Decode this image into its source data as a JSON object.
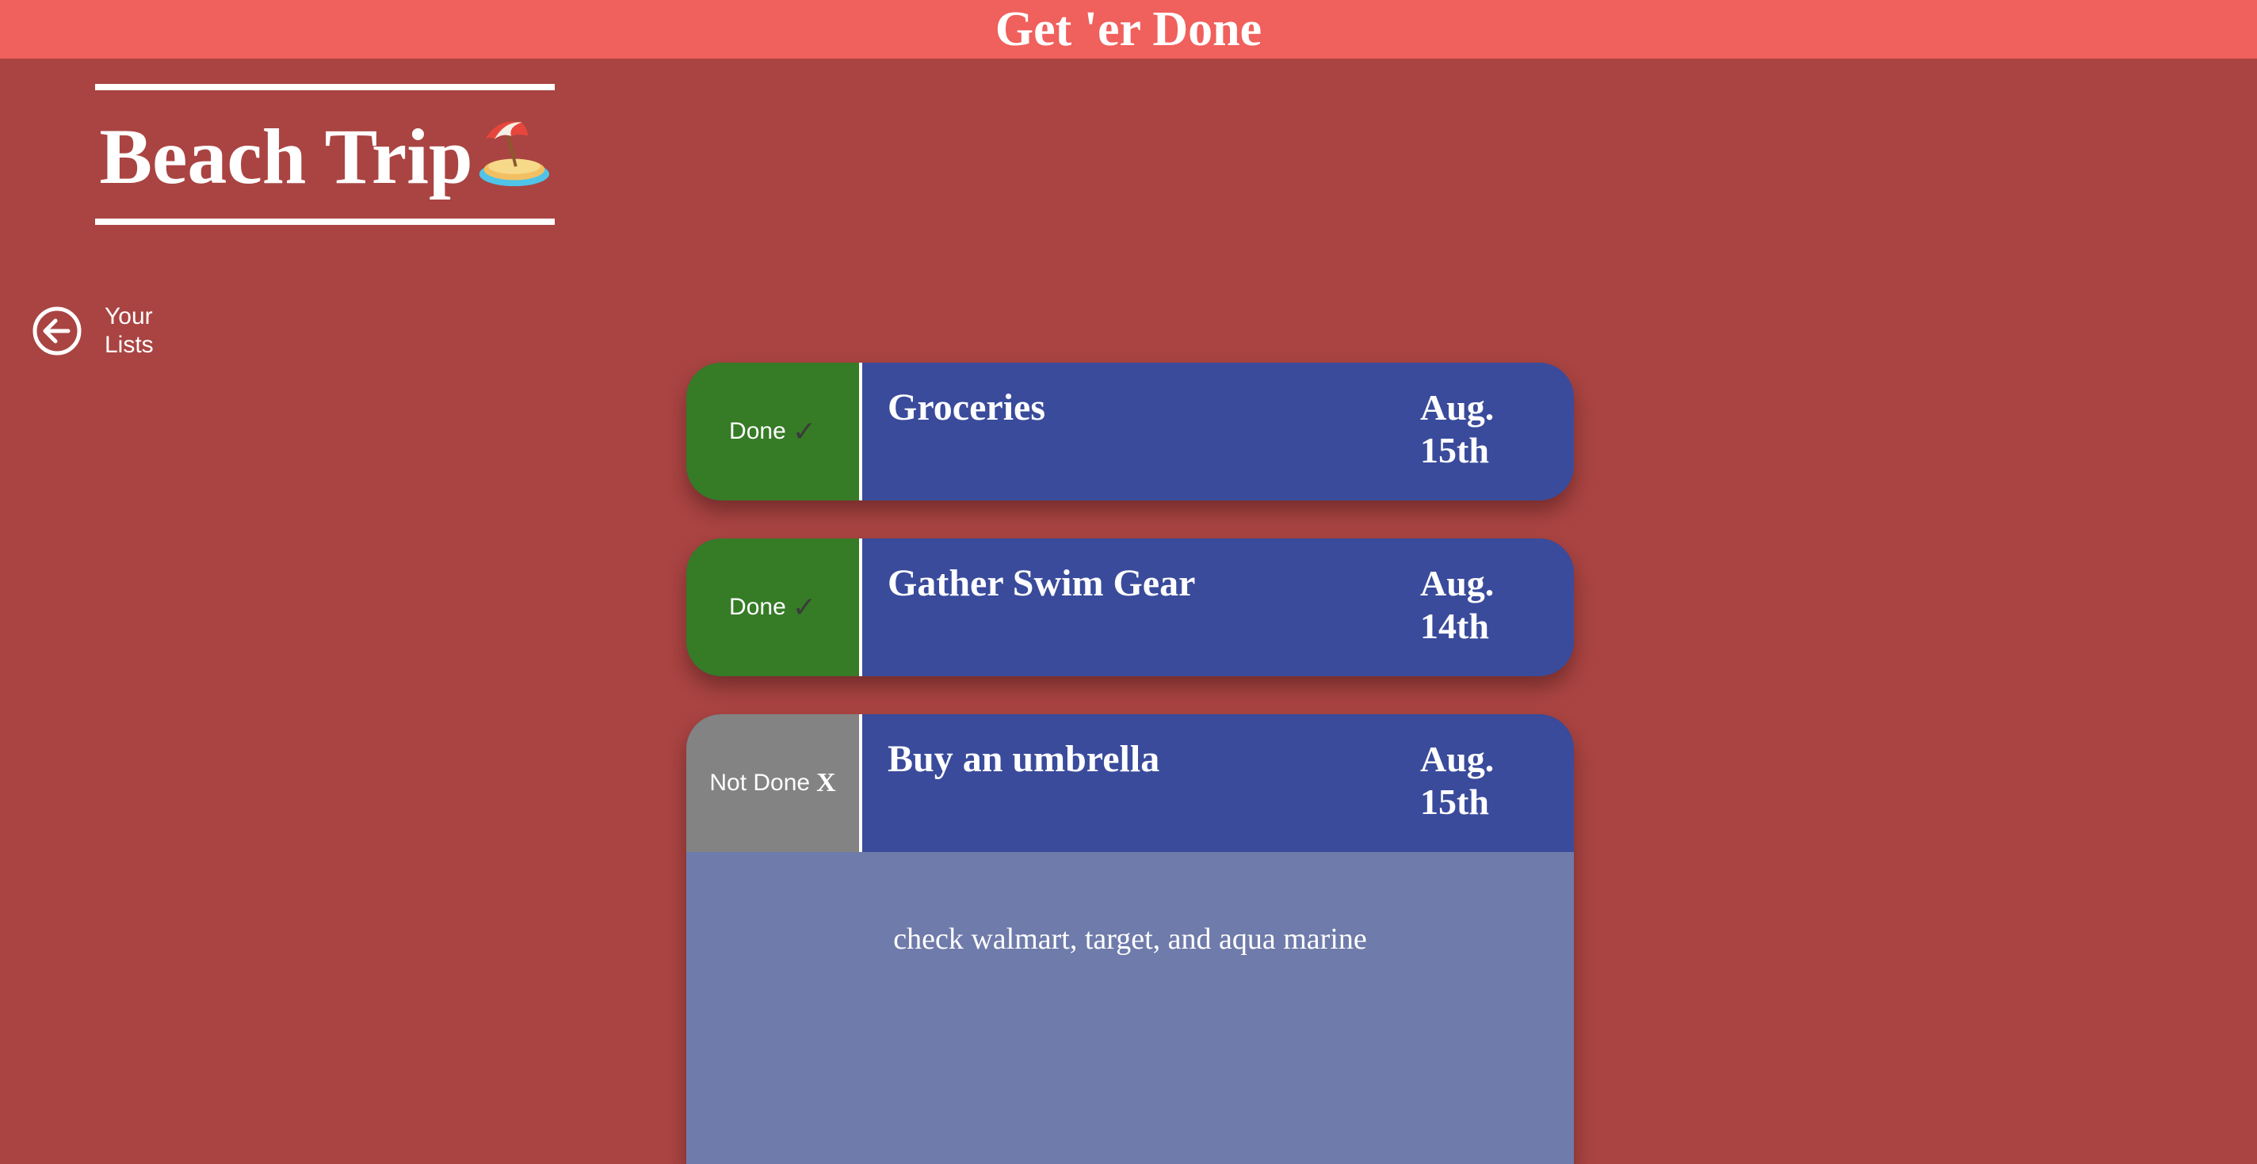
{
  "app": {
    "title": "Get 'er Done"
  },
  "list": {
    "title": "Beach Trip",
    "icon": "beach-umbrella-island-icon"
  },
  "nav": {
    "back_label": "Your Lists",
    "back_icon": "arrow-left-circle-icon"
  },
  "colors": {
    "header_bg": "#f0605c",
    "page_bg": "#a94442",
    "task_bg": "#3a4b9b",
    "done_bg": "#367b26",
    "not_done_bg": "#838383",
    "details_bg": "#6f7baa"
  },
  "tasks": [
    {
      "name": "Groceries",
      "date": "Aug. 15th",
      "status_label": "Done",
      "status_mark": "✓",
      "done": true
    },
    {
      "name": "Gather Swim Gear",
      "date": "Aug. 14th",
      "status_label": "Done",
      "status_mark": "✓",
      "done": true
    },
    {
      "name": "Buy an umbrella",
      "date": "Aug. 15th",
      "status_label": "Not Done",
      "status_mark": "X",
      "done": false,
      "details": "check walmart, target, and aqua marine"
    }
  ]
}
